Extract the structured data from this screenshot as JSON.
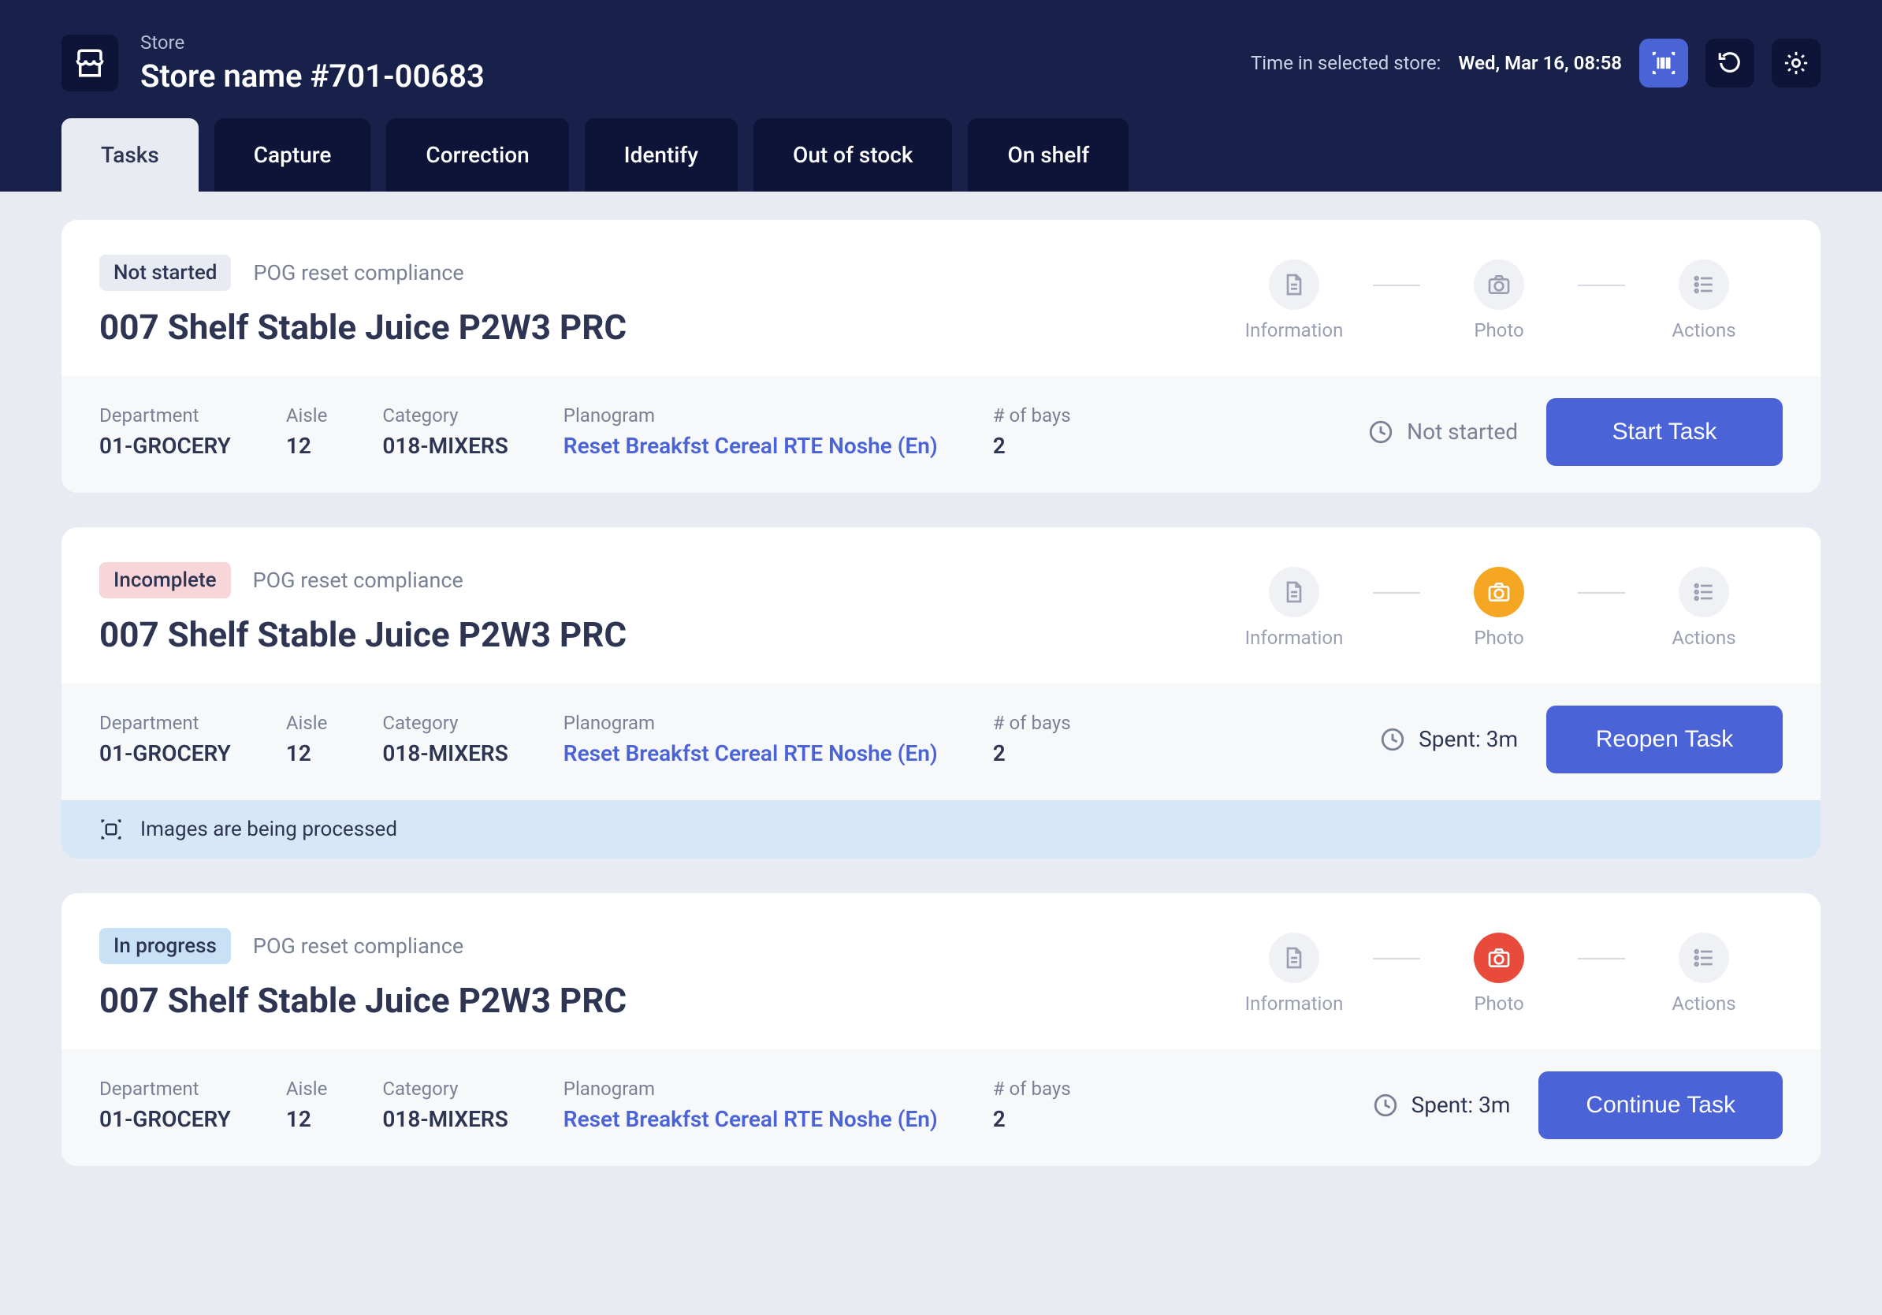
{
  "header": {
    "store_label": "Store",
    "store_name": "Store name #701-00683",
    "time_label": "Time in selected store:",
    "time_value": "Wed, Mar 16, 08:58"
  },
  "tabs": [
    {
      "label": "Tasks",
      "active": true
    },
    {
      "label": "Capture"
    },
    {
      "label": "Correction"
    },
    {
      "label": "Identify"
    },
    {
      "label": "Out of stock"
    },
    {
      "label": "On shelf"
    }
  ],
  "steps": {
    "information": "Information",
    "photo": "Photo",
    "actions": "Actions"
  },
  "meta_labels": {
    "department": "Department",
    "aisle": "Aisle",
    "category": "Category",
    "planogram": "Planogram",
    "bays": "# of bays"
  },
  "tasks": [
    {
      "status_text": "Not started",
      "status_color": "grey",
      "type": "POG reset compliance",
      "title": "007 Shelf Stable Juice P2W3 PRC",
      "department": "01-GROCERY",
      "aisle": "12",
      "category": "018-MIXERS",
      "planogram": "Reset Breakfst Cereal RTE Noshe (En)",
      "bays": "2",
      "duration_text": "Not started",
      "duration_faint": true,
      "action_text": "Start Task",
      "photo_state": "none",
      "banner": null
    },
    {
      "status_text": "Incomplete",
      "status_color": "pink",
      "type": "POG reset compliance",
      "title": "007 Shelf Stable Juice P2W3 PRC",
      "department": "01-GROCERY",
      "aisle": "12",
      "category": "018-MIXERS",
      "planogram": "Reset Breakfst Cereal RTE Noshe (En)",
      "bays": "2",
      "duration_text": "Spent: 3m",
      "duration_faint": false,
      "action_text": "Reopen Task",
      "photo_state": "orange",
      "banner": "Images are being processed"
    },
    {
      "status_text": "In progress",
      "status_color": "blue",
      "type": "POG reset compliance",
      "title": "007 Shelf Stable Juice P2W3 PRC",
      "department": "01-GROCERY",
      "aisle": "12",
      "category": "018-MIXERS",
      "planogram": "Reset Breakfst Cereal RTE Noshe (En)",
      "bays": "2",
      "duration_text": "Spent: 3m",
      "duration_faint": false,
      "action_text": "Continue Task",
      "photo_state": "red",
      "banner": null
    }
  ]
}
